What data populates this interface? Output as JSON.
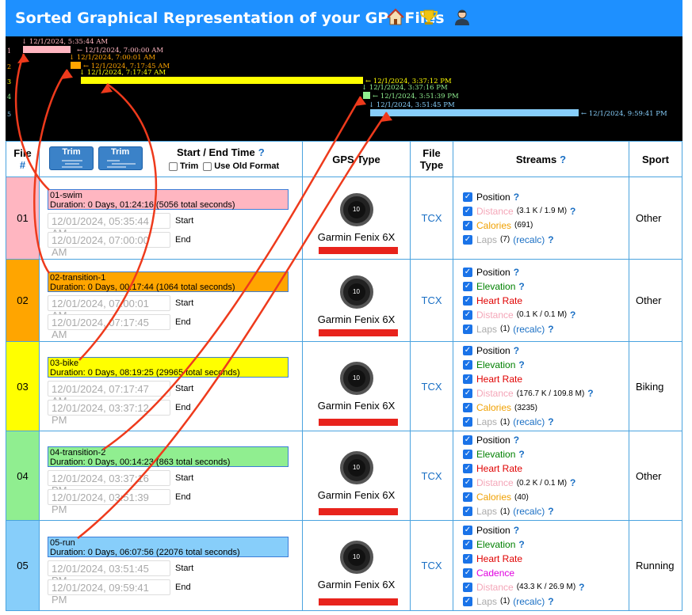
{
  "header": {
    "title": "Sorted Graphical Representation of your GPS Files",
    "icons": [
      "home-icon",
      "trophy-icon",
      "user-icon"
    ]
  },
  "timeline": {
    "rows": [
      {
        "num": "1",
        "start_label": "12/1/2024, 5:35:44 AM",
        "end_label": "12/1/2024, 7:00:00 AM",
        "color": "#ffb6c1"
      },
      {
        "num": "2",
        "start_label": "12/1/2024, 7:00:01 AM",
        "end_label": "12/1/2024, 7:17:45 AM",
        "color": "#ffa500"
      },
      {
        "num": "3",
        "start_label": "12/1/2024, 7:17:47 AM",
        "end_label": "12/1/2024, 3:37:12 PM",
        "color": "#ffff00"
      },
      {
        "num": "4",
        "start_label": "12/1/2024, 3:37:16 PM",
        "end_label": "12/1/2024, 3:51:39 PM",
        "color": "#90ee90"
      },
      {
        "num": "5",
        "start_label": "12/1/2024, 3:51:45 PM",
        "end_label": "12/1/2024, 9:59:41 PM",
        "color": "#87cefa"
      }
    ]
  },
  "table_header": {
    "file": "File",
    "file_hash": "#",
    "trim1": "Trim",
    "trim2": "Trim",
    "start_end": "Start / End Time",
    "q": "?",
    "trim_cb": "Trim",
    "old_format_cb": "Use Old Format",
    "gps_type": "GPS Type",
    "file_type": "File Type",
    "streams": "Streams",
    "sport": "Sport"
  },
  "rows": [
    {
      "num": "01",
      "color": "#ffb6c1",
      "name": "01-swim",
      "duration": "Duration: 0 Days, 01:24:16 (5056 total seconds)",
      "start": "12/01/2024, 05:35:44 AM",
      "end": "12/01/2024, 07:00:00 AM",
      "start_label": "Start",
      "end_label": "End",
      "gps": "Garmin Fenix 6X",
      "ftype": "TCX",
      "sport": "Other",
      "streams": [
        {
          "name": "Position",
          "color": "#000000",
          "extra": "",
          "q": "?"
        },
        {
          "name": "Distance",
          "color": "#f4a6b8",
          "extra": "(3.1 K / 1.9 M)",
          "q": "?"
        },
        {
          "name": "Calories",
          "color": "#f0a000",
          "extra": "(691)",
          "q": ""
        },
        {
          "name": "Laps",
          "color": "#aaaaaa",
          "extra": "(7)",
          "recalc": "(recalc)",
          "q": "?"
        }
      ]
    },
    {
      "num": "02",
      "color": "#ffa500",
      "name": "02-transition-1",
      "duration": "Duration: 0 Days, 00:17:44 (1064 total seconds)",
      "start": "12/01/2024, 07:00:01 AM",
      "end": "12/01/2024, 07:17:45 AM",
      "start_label": "Start",
      "end_label": "End",
      "gps": "Garmin Fenix 6X",
      "ftype": "TCX",
      "sport": "Other",
      "streams": [
        {
          "name": "Position",
          "color": "#000000",
          "extra": "",
          "q": "?"
        },
        {
          "name": "Elevation",
          "color": "#008000",
          "extra": "",
          "q": "?"
        },
        {
          "name": "Heart Rate",
          "color": "#e00000",
          "extra": "",
          "q": ""
        },
        {
          "name": "Distance",
          "color": "#f4a6b8",
          "extra": "(0.1 K / 0.1 M)",
          "q": "?"
        },
        {
          "name": "Laps",
          "color": "#aaaaaa",
          "extra": "(1)",
          "recalc": "(recalc)",
          "q": "?"
        }
      ]
    },
    {
      "num": "03",
      "color": "#ffff00",
      "name": "03-bike",
      "duration": "Duration: 0 Days, 08:19:25 (29965 total seconds)",
      "start": "12/01/2024, 07:17:47 AM",
      "end": "12/01/2024, 03:37:12 PM",
      "start_label": "Start",
      "end_label": "End",
      "gps": "Garmin Fenix 6X",
      "ftype": "TCX",
      "sport": "Biking",
      "streams": [
        {
          "name": "Position",
          "color": "#000000",
          "extra": "",
          "q": "?"
        },
        {
          "name": "Elevation",
          "color": "#008000",
          "extra": "",
          "q": "?"
        },
        {
          "name": "Heart Rate",
          "color": "#e00000",
          "extra": "",
          "q": ""
        },
        {
          "name": "Distance",
          "color": "#f4a6b8",
          "extra": "(176.7 K / 109.8 M)",
          "q": "?"
        },
        {
          "name": "Calories",
          "color": "#f0a000",
          "extra": "(3235)",
          "q": ""
        },
        {
          "name": "Laps",
          "color": "#aaaaaa",
          "extra": "(1)",
          "recalc": "(recalc)",
          "q": "?"
        }
      ]
    },
    {
      "num": "04",
      "color": "#90ee90",
      "name": "04-transition-2",
      "duration": "Duration: 0 Days, 00:14:23 (863 total seconds)",
      "start": "12/01/2024, 03:37:16 PM",
      "end": "12/01/2024, 03:51:39 PM",
      "start_label": "Start",
      "end_label": "End",
      "gps": "Garmin Fenix 6X",
      "ftype": "TCX",
      "sport": "Other",
      "streams": [
        {
          "name": "Position",
          "color": "#000000",
          "extra": "",
          "q": "?"
        },
        {
          "name": "Elevation",
          "color": "#008000",
          "extra": "",
          "q": "?"
        },
        {
          "name": "Heart Rate",
          "color": "#e00000",
          "extra": "",
          "q": ""
        },
        {
          "name": "Distance",
          "color": "#f4a6b8",
          "extra": "(0.2 K / 0.1 M)",
          "q": "?"
        },
        {
          "name": "Calories",
          "color": "#f0a000",
          "extra": "(40)",
          "q": ""
        },
        {
          "name": "Laps",
          "color": "#aaaaaa",
          "extra": "(1)",
          "recalc": "(recalc)",
          "q": "?"
        }
      ]
    },
    {
      "num": "05",
      "color": "#87cefa",
      "name": "05-run",
      "duration": "Duration: 0 Days, 06:07:56 (22076 total seconds)",
      "start": "12/01/2024, 03:51:45 PM",
      "end": "12/01/2024, 09:59:41 PM",
      "start_label": "Start",
      "end_label": "End",
      "gps": "Garmin Fenix 6X",
      "ftype": "TCX",
      "sport": "Running",
      "streams": [
        {
          "name": "Position",
          "color": "#000000",
          "extra": "",
          "q": "?"
        },
        {
          "name": "Elevation",
          "color": "#008000",
          "extra": "",
          "q": "?"
        },
        {
          "name": "Heart Rate",
          "color": "#e00000",
          "extra": "",
          "q": ""
        },
        {
          "name": "Cadence",
          "color": "#e000e0",
          "extra": "",
          "q": ""
        },
        {
          "name": "Distance",
          "color": "#f4a6b8",
          "extra": "(43.3 K / 26.9 M)",
          "q": "?"
        },
        {
          "name": "Laps",
          "color": "#aaaaaa",
          "extra": "(1)",
          "recalc": "(recalc)",
          "q": "?"
        }
      ]
    }
  ],
  "watch_face": "10"
}
